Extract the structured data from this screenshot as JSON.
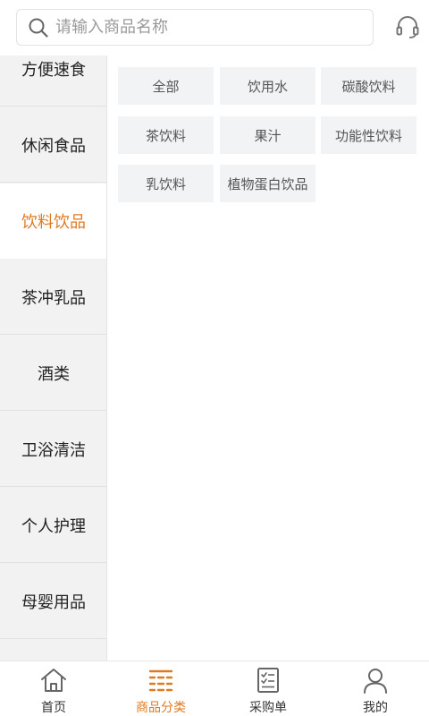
{
  "search": {
    "placeholder": "请输入商品名称"
  },
  "colors": {
    "accent": "#e07a1f",
    "sidebar_bg": "#f2f2f2",
    "chip_bg": "#f2f3f4"
  },
  "icons": {
    "search": "search-icon",
    "service": "headset-icon"
  },
  "sidebar": {
    "items": [
      {
        "label": "方便速食",
        "active": false
      },
      {
        "label": "休闲食品",
        "active": false
      },
      {
        "label": "饮料饮品",
        "active": true
      },
      {
        "label": "茶冲乳品",
        "active": false
      },
      {
        "label": "酒类",
        "active": false
      },
      {
        "label": "卫浴清洁",
        "active": false
      },
      {
        "label": "个人护理",
        "active": false
      },
      {
        "label": "母婴用品",
        "active": false
      }
    ]
  },
  "subcategories": [
    {
      "label": "全部"
    },
    {
      "label": "饮用水"
    },
    {
      "label": "碳酸饮料"
    },
    {
      "label": "茶饮料"
    },
    {
      "label": "果汁"
    },
    {
      "label": "功能性饮料"
    },
    {
      "label": "乳饮料"
    },
    {
      "label": "植物蛋白饮品"
    }
  ],
  "tabbar": {
    "tabs": [
      {
        "label": "首页",
        "icon": "home-icon",
        "active": false
      },
      {
        "label": "商品分类",
        "icon": "category-icon",
        "active": true
      },
      {
        "label": "采购单",
        "icon": "order-list-icon",
        "active": false
      },
      {
        "label": "我的",
        "icon": "user-icon",
        "active": false
      }
    ]
  }
}
